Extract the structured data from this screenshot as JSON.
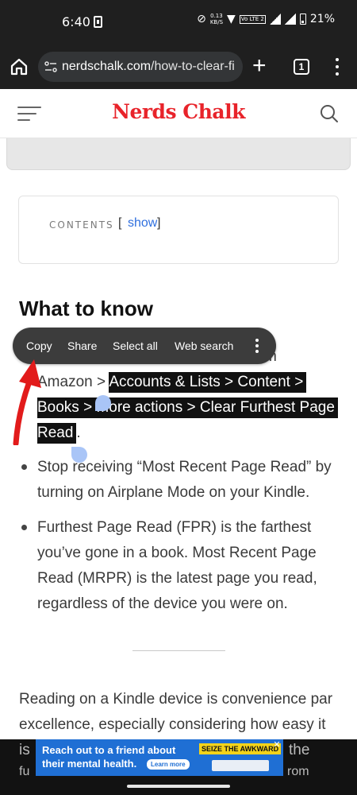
{
  "status_bar": {
    "time": "6:40",
    "speed_value": "0.13",
    "speed_unit": "KB/S",
    "lte_label": "Vo LTE 2",
    "battery": "21%"
  },
  "browser": {
    "url_host": "nerdschalk.com",
    "url_path": "/how-to-clear-fi",
    "tab_count": "1"
  },
  "site": {
    "logo": "Nerds Chalk",
    "accent_color": "#e8232a"
  },
  "toc": {
    "label": "CONTENTS",
    "bracket_open": "[",
    "show_link": "show",
    "bracket_close": "]"
  },
  "section_heading": "What to know",
  "context_menu": {
    "items": [
      "Copy",
      "Share",
      "Select all",
      "Web search"
    ],
    "more_icon": "more-vert-icon"
  },
  "bullets": {
    "b1_line1_hidden": "m",
    "b1_line2_plain": "Amazon > ",
    "b1_line2_sel": "Accounts & Lists > Content >",
    "b1_line3_sel": "Books > More actions > Clear Furthest Page",
    "b1_line4_sel": "Read",
    "b1_line4_tail": ".",
    "b2_line1": "Stop receiving “Most Recent Page Read” by",
    "b2_line2": "turning on Airplane Mode on your Kindle.",
    "b3_line1": "Furthest Page Read (FPR) is the farthest",
    "b3_line2": "you’ve gone in a book. Most Recent Page",
    "b3_line3": "Read (MRPR) is the latest page you read,",
    "b3_line4": "regardless of the device you were on."
  },
  "paragraph": {
    "line1": "Reading on a Kindle device is convenience par",
    "line2": "excellence, especially considering how easy it",
    "line3_left": "is",
    "line3_right": "the",
    "line4_left": "fu",
    "line4_right": "rom"
  },
  "banner_ad": {
    "line1": "Reach out to a friend about",
    "line2": "their mental health.",
    "learn_more": "Learn more",
    "tag": "SEIZE THE AWKWARD",
    "close": "✕",
    "background_color": "#1f6fd4"
  }
}
